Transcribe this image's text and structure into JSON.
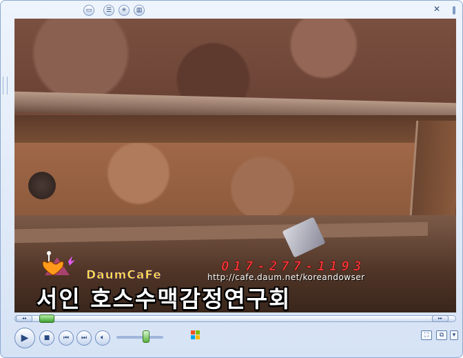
{
  "titlebar": {
    "close_glyph": "✕",
    "icons": [
      "folder-icon",
      "list-icon",
      "visualization-icon",
      "equalizer-icon"
    ]
  },
  "video": {
    "overlay": {
      "logo_text": "DaumCaFe",
      "phone": "017-277-1193",
      "url": "http://cafe.daum.net/koreandowser",
      "org_name": "서인 호스수맥감정연구회"
    }
  },
  "player": {
    "seek_left_glyph": "◂◂",
    "seek_right_glyph": "▸▸",
    "seek_progress": 0.07,
    "volume_level": 0.6,
    "buttons": [
      "play-button",
      "stop-button",
      "previous-button",
      "next-button",
      "mute-button"
    ]
  },
  "colors": {
    "window_bg": "#d6e3f5",
    "window_border": "#8aa7cf",
    "accent_green": "#3fa030",
    "phone_red": "#ff3b3b",
    "logo_yellow": "#ffe34d"
  }
}
